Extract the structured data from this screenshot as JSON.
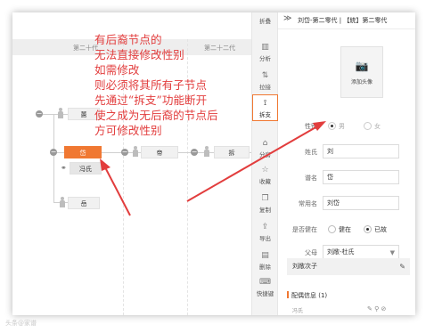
{
  "annotation": {
    "lines": [
      "有后裔节点的",
      "无法直接修改性别",
      "如需修改",
      "则必须将其所有子节点",
      "先通过“拆支”功能断开",
      "使之成为无后裔的节点后",
      "方可修改性别"
    ],
    "color": "#e23d3d"
  },
  "tree": {
    "generations": [
      "第二十代",
      "第二十二代"
    ],
    "nodes": {
      "n1": "蕙",
      "selected": "岱",
      "spouse": "冯氏",
      "n4": "岳",
      "n5": "帝",
      "n6": "拆"
    },
    "selected_color": "#f07832"
  },
  "toolbar": {
    "fold": "折叠",
    "items": [
      "分析",
      "拉接",
      "拆支",
      "分房",
      "收藏",
      "复制",
      "导出",
      "删除",
      "快捷键"
    ],
    "active": "拆支"
  },
  "panel": {
    "title": "刘岱-第二零代 | 【統】第二零代",
    "photo_label": "添加头像",
    "gender": {
      "label": "性别",
      "male": "男",
      "female": "女"
    },
    "fields": [
      {
        "label": "姓氏",
        "value": "刘"
      },
      {
        "label": "谱名",
        "value": "岱"
      },
      {
        "label": "常用名",
        "value": "刘岱"
      }
    ],
    "alive": {
      "label": "是否健在",
      "yes": "健在",
      "no": "已故",
      "selected": "已故"
    },
    "parents": {
      "label": "父母",
      "value": "刘敞-杜氏"
    },
    "mother_text": "刘敞次子",
    "spouse_section": "配偶信息 (1)",
    "spouse_item": "冯氏"
  },
  "watermark": "头条@家谱"
}
